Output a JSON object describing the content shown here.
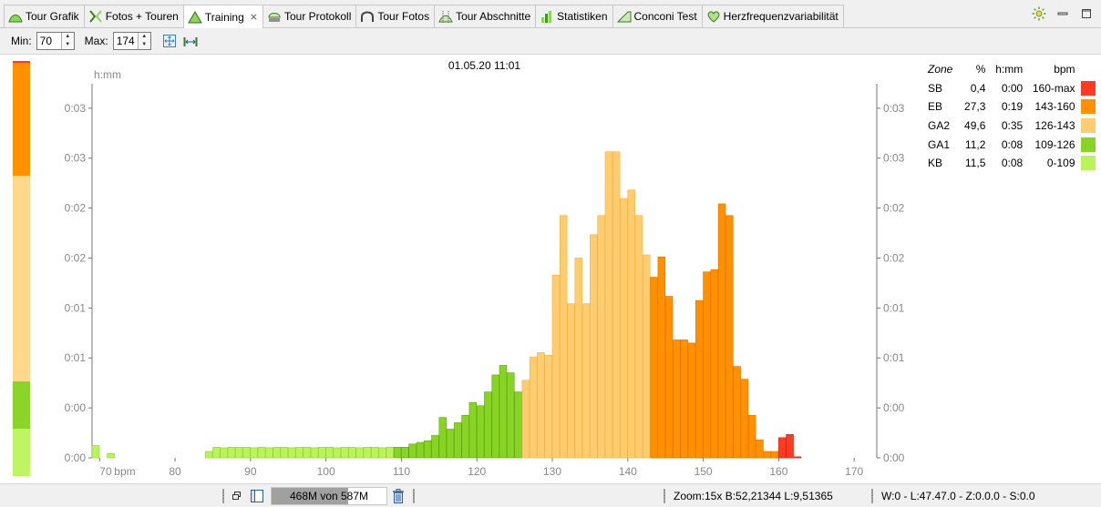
{
  "tabs": [
    {
      "label": "Tour Grafik",
      "icon": "tour-graph-icon",
      "active": false
    },
    {
      "label": "Fotos + Touren",
      "icon": "photos-tours-icon",
      "active": false
    },
    {
      "label": "Training",
      "icon": "training-icon",
      "active": true,
      "closable": true
    },
    {
      "label": "Tour Protokoll",
      "icon": "tour-log-icon",
      "active": false
    },
    {
      "label": "Tour Fotos",
      "icon": "tour-photos-icon",
      "active": false
    },
    {
      "label": "Tour Abschnitte",
      "icon": "tour-segments-icon",
      "active": false
    },
    {
      "label": "Statistiken",
      "icon": "statistics-icon",
      "active": false
    },
    {
      "label": "Conconi Test",
      "icon": "conconi-icon",
      "active": false
    },
    {
      "label": "Herzfrequenzvariabilität",
      "icon": "heart-icon",
      "active": false
    }
  ],
  "toolbar": {
    "min_label": "Min:",
    "min_value": "70",
    "max_label": "Max:",
    "max_value": "174"
  },
  "legend": {
    "headers": {
      "zone": "Zone",
      "pct": "%",
      "time": "h:mm",
      "bpm": "bpm"
    },
    "rows": [
      {
        "zone": "SB",
        "pct": "0,4",
        "time": "0:00",
        "bpm": "160-max",
        "color": "#ff3a22"
      },
      {
        "zone": "EB",
        "pct": "27,3",
        "time": "0:19",
        "bpm": "143-160",
        "color": "#ff9000"
      },
      {
        "zone": "GA2",
        "pct": "49,6",
        "time": "0:35",
        "bpm": "126-143",
        "color": "#ffcd70"
      },
      {
        "zone": "GA1",
        "pct": "11,2",
        "time": "0:08",
        "bpm": "109-126",
        "color": "#88d424"
      },
      {
        "zone": "KB",
        "pct": "11,5",
        "time": "0:08",
        "bpm": "0-109",
        "color": "#b9f55a"
      }
    ]
  },
  "zone_bar": [
    {
      "zone": "SB",
      "fraction": 0.004,
      "color": "#ff3a22"
    },
    {
      "zone": "EB",
      "fraction": 0.273,
      "color": "#ff9000"
    },
    {
      "zone": "GA2",
      "fraction": 0.496,
      "color": "#ffd88c"
    },
    {
      "zone": "GA1",
      "fraction": 0.112,
      "color": "#8bd42a"
    },
    {
      "zone": "KB",
      "fraction": 0.115,
      "color": "#bff562"
    }
  ],
  "chart_data": {
    "type": "bar",
    "title": "01.05.20 11:01",
    "xlabel": "bpm",
    "ylabel": "h:mm",
    "xlim": [
      69,
      173
    ],
    "ylim": [
      0,
      0.0352
    ],
    "y_ticks": [
      0,
      0.0047,
      0.0094,
      0.0141,
      0.0188,
      0.0235,
      0.0282,
      0.0329
    ],
    "y_tick_labels": [
      "0:00",
      "0:00",
      "0:01",
      "0:01",
      "0:02",
      "0:02",
      "0:03",
      "0:03"
    ],
    "x_ticks": [
      70,
      80,
      90,
      100,
      110,
      120,
      130,
      140,
      150,
      160,
      170
    ],
    "x_tick_labels": [
      "70",
      "80",
      "90",
      "100",
      "110",
      "120",
      "130",
      "140",
      "150",
      "160",
      "170"
    ],
    "grid": false,
    "zones": [
      {
        "name": "KB",
        "from": 0,
        "to": 109,
        "color": "#b9f55a",
        "edge": "#8fd12e"
      },
      {
        "name": "GA1",
        "from": 109,
        "to": 126,
        "color": "#88d424",
        "edge": "#5fa312"
      },
      {
        "name": "GA2",
        "from": 126,
        "to": 143,
        "color": "#ffcd70",
        "edge": "#f0b240"
      },
      {
        "name": "EB",
        "from": 143,
        "to": 160,
        "color": "#ff9000",
        "edge": "#e07400"
      },
      {
        "name": "SB",
        "from": 160,
        "to": 999,
        "color": "#ff3a22",
        "edge": "#d81e0c"
      }
    ],
    "bpm": [
      69,
      71,
      84,
      85,
      86,
      87,
      88,
      89,
      90,
      91,
      92,
      93,
      94,
      95,
      96,
      97,
      98,
      99,
      100,
      101,
      102,
      103,
      104,
      105,
      106,
      107,
      108,
      109,
      110,
      111,
      112,
      113,
      114,
      115,
      116,
      117,
      118,
      119,
      120,
      121,
      122,
      123,
      124,
      125,
      126,
      127,
      128,
      129,
      130,
      131,
      132,
      133,
      134,
      135,
      136,
      137,
      138,
      139,
      140,
      141,
      142,
      143,
      144,
      145,
      146,
      147,
      148,
      149,
      150,
      151,
      152,
      153,
      154,
      155,
      156,
      157,
      158,
      159,
      160,
      161,
      162
    ],
    "hours": [
      0.00115,
      0.0004,
      0.0006,
      0.001,
      0.00095,
      0.001,
      0.001,
      0.001,
      0.00095,
      0.001,
      0.00095,
      0.001,
      0.001,
      0.00095,
      0.001,
      0.001,
      0.00095,
      0.001,
      0.001,
      0.00095,
      0.001,
      0.001,
      0.00095,
      0.001,
      0.001,
      0.00095,
      0.001,
      0.001,
      0.001,
      0.0013,
      0.00145,
      0.0016,
      0.0021,
      0.0038,
      0.0027,
      0.0033,
      0.004,
      0.0052,
      0.0049,
      0.0062,
      0.0078,
      0.0087,
      0.008,
      0.0062,
      0.0073,
      0.0095,
      0.0099,
      0.00965,
      0.0172,
      0.0228,
      0.0145,
      0.0188,
      0.0145,
      0.021,
      0.0228,
      0.0288,
      0.0288,
      0.0244,
      0.0252,
      0.0228,
      0.0191,
      0.017,
      0.0189,
      0.0152,
      0.0111,
      0.0111,
      0.0108,
      0.0148,
      0.0175,
      0.0177,
      0.0239,
      0.0228,
      0.0086,
      0.0074,
      0.004,
      0.0017,
      0.0006,
      0.0006,
      0.0019,
      0.0022,
      0.0001
    ]
  },
  "status": {
    "heap_text": "468M von 587M",
    "heap_fraction": 0.797,
    "zoom_text": "Zoom:15x  B:52,21344  L:9,51365",
    "position_text": "W:0 - L:47.47.0 - Z:0.0.0 - S:0.0"
  }
}
